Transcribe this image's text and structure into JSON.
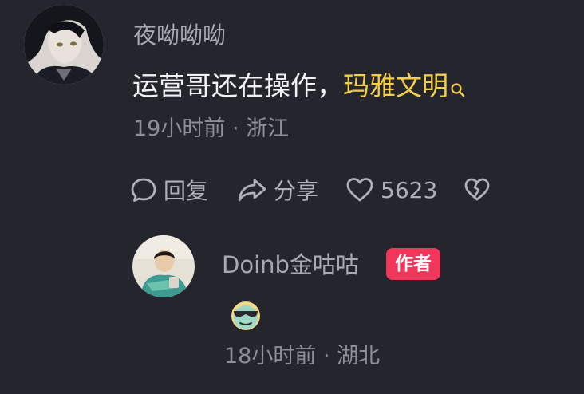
{
  "comment": {
    "username": "夜呦呦呦",
    "text": "运营哥还在操作，",
    "highlight_keyword": "玛雅文明",
    "highlight_color": "#f6cf4a",
    "time": "19小时前",
    "location": "浙江",
    "meta_separator": "·",
    "actions": {
      "reply_label": "回复",
      "share_label": "分享",
      "like_count": "5623"
    },
    "icons": [
      "search-icon",
      "comment-icon",
      "share-icon",
      "heart-icon",
      "dislike-heart-icon"
    ]
  },
  "reply": {
    "username": "Doinb金咕咕",
    "badge": "作者",
    "badge_color": "#f0365a",
    "emoji": "sunglasses-face-emoji",
    "time": "18小时前",
    "location": "湖北",
    "meta_separator": "·"
  }
}
